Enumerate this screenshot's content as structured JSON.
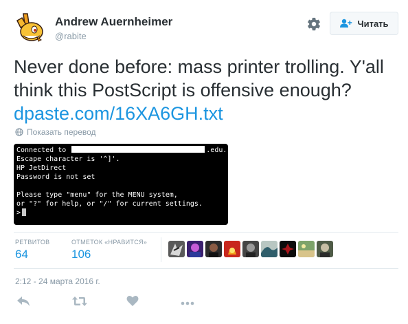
{
  "user": {
    "name": "Andrew Auernheimer",
    "handle": "@rabite"
  },
  "follow_label": "Читать",
  "tweet": {
    "line1": "Never done before: mass printer trolling. Y'all",
    "line2": "think this PostScript is offensive enough?",
    "link": "dpaste.com/16XA6GH.txt"
  },
  "translate_label": "Показать перевод",
  "terminal": {
    "line1_pre": "Connected to ",
    "line1_post": ".edu.",
    "lines": [
      "Escape character is '^]'.",
      "HP JetDirect",
      "Password is not set",
      "",
      "Please type \"menu\" for the MENU system,",
      "or \"?\" for help, or \"/\" for current settings."
    ],
    "prompt": ">"
  },
  "stats": {
    "retweets_label": "РЕТВИТОВ",
    "retweets": "64",
    "likes_label": "ОТМЕТОК «НРАВИТСЯ»",
    "likes": "106"
  },
  "timestamp": "2:12 - 24 марта 2016 г.",
  "icons": {
    "gear": "gear-icon",
    "follow": "add-user-icon",
    "globe": "globe-icon",
    "reply": "reply-icon",
    "retweet": "retweet-icon",
    "like": "heart-icon",
    "more": "more-icon"
  },
  "colors": {
    "link": "#1b95e0",
    "muted": "#8899a6",
    "icon": "#aab8c2",
    "text": "#292f33"
  }
}
